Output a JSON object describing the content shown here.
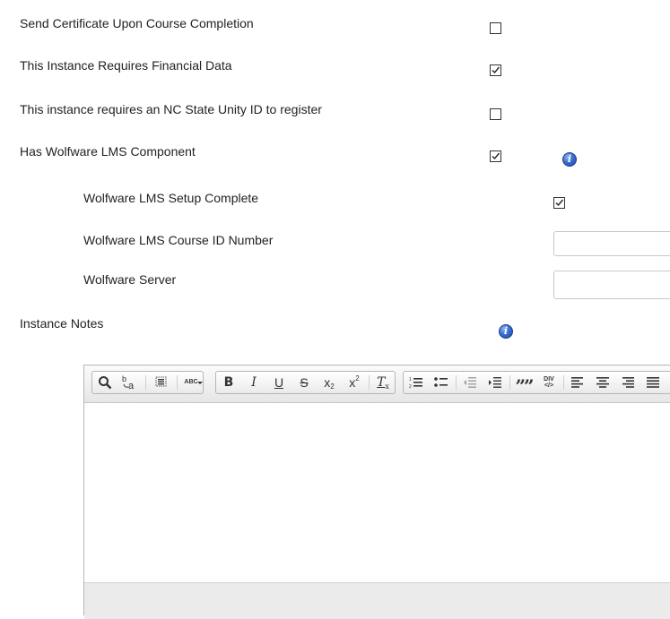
{
  "settings": {
    "send_certificate": {
      "label": "Send Certificate Upon Course Completion",
      "checked": false
    },
    "financial_data": {
      "label": "This Instance Requires Financial Data",
      "checked": true
    },
    "unity_id": {
      "label": "This instance requires an NC State Unity ID to register",
      "checked": false
    },
    "wolfware": {
      "label": "Has Wolfware LMS Component",
      "checked": true
    },
    "wolfware_setup": {
      "label": "Wolfware LMS Setup Complete",
      "checked": true
    },
    "wolfware_course_id": {
      "label": "Wolfware LMS Course ID Number",
      "value": ""
    },
    "wolfware_server": {
      "label": "Wolfware Server",
      "value": ""
    },
    "instance_notes": {
      "label": "Instance Notes"
    }
  },
  "info_icon_glyph": "i",
  "editor": {
    "toolbar": {
      "find_icon": "search-icon",
      "replace_icon": "replace-icon",
      "select_all_icon": "select-all-icon",
      "spellcheck_label": "ABC",
      "bold": "B",
      "italic": "I",
      "underline": "U",
      "strike": "S",
      "subscript": "x",
      "superscript": "x",
      "remove_format": "T",
      "blockquote": "””",
      "div_label": "DIV"
    },
    "content": ""
  },
  "colors": {
    "info": "#2f62c6",
    "border": "#b6b6b6",
    "toolbar_bg": "#e6e6e6"
  }
}
